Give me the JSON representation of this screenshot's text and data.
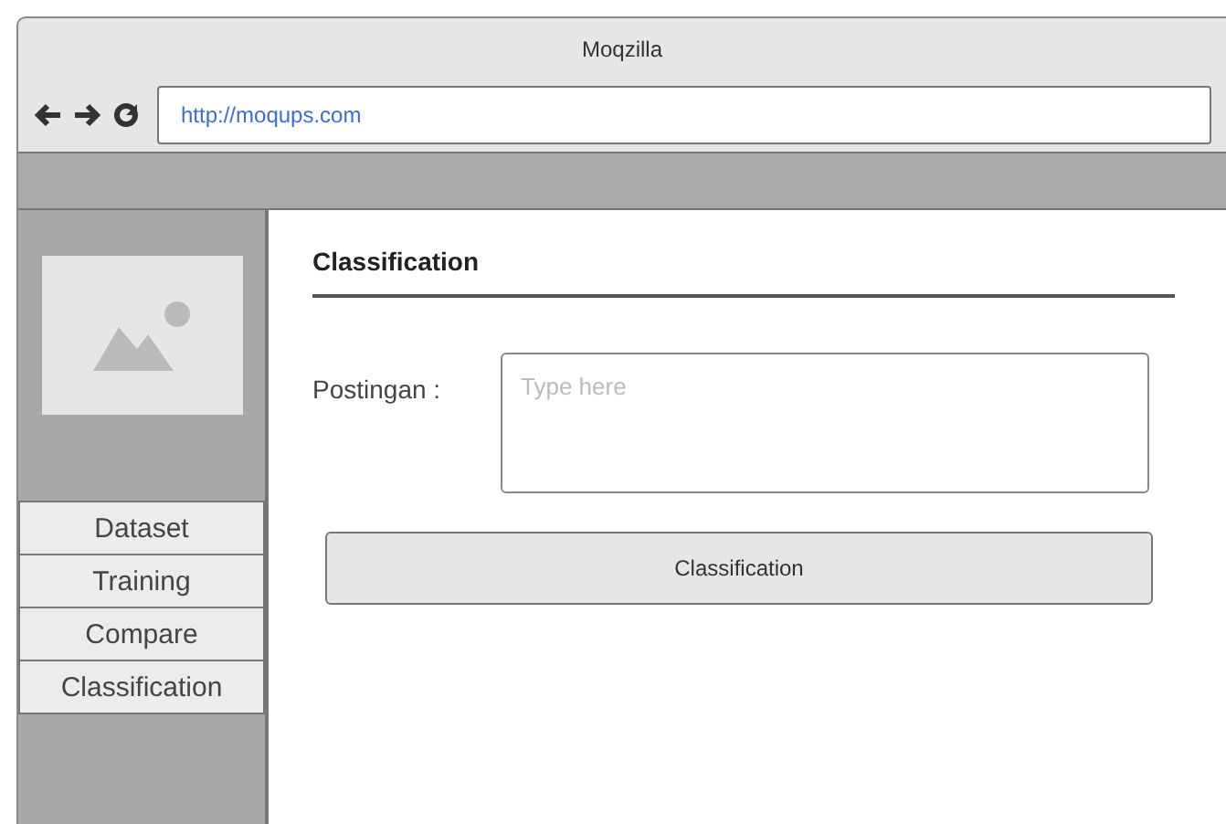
{
  "window": {
    "title": "Moqzilla"
  },
  "address_bar": {
    "url": "http://moqups.com"
  },
  "sidebar": {
    "items": [
      {
        "label": "Dataset"
      },
      {
        "label": "Training"
      },
      {
        "label": "Compare"
      },
      {
        "label": "Classification"
      }
    ]
  },
  "content": {
    "heading": "Classification",
    "field_label": "Postingan :",
    "field": {
      "placeholder": "Type here"
    },
    "button": "Classification"
  }
}
